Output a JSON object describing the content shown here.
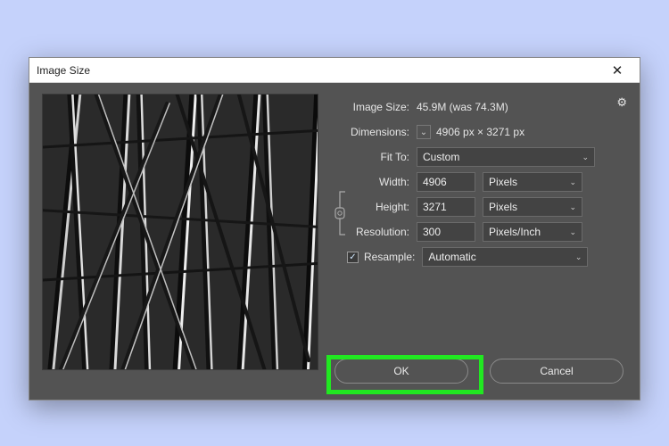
{
  "dialog": {
    "title": "Image Size",
    "close_icon": "✕",
    "gear_icon": "⚙"
  },
  "info": {
    "image_size_label": "Image Size:",
    "image_size_value": "45.9M (was 74.3M)",
    "dimensions_label": "Dimensions:",
    "dimensions_value": "4906 px  ×  3271 px",
    "dimensions_chev": "⌄"
  },
  "fit": {
    "label": "Fit To:",
    "value": "Custom"
  },
  "width": {
    "label": "Width:",
    "value": "4906",
    "unit": "Pixels"
  },
  "height": {
    "label": "Height:",
    "value": "3271",
    "unit": "Pixels"
  },
  "resolution": {
    "label": "Resolution:",
    "value": "300",
    "unit": "Pixels/Inch"
  },
  "resample": {
    "label": "Resample:",
    "checked": "✓",
    "value": "Automatic"
  },
  "buttons": {
    "ok": "OK",
    "cancel": "Cancel"
  }
}
